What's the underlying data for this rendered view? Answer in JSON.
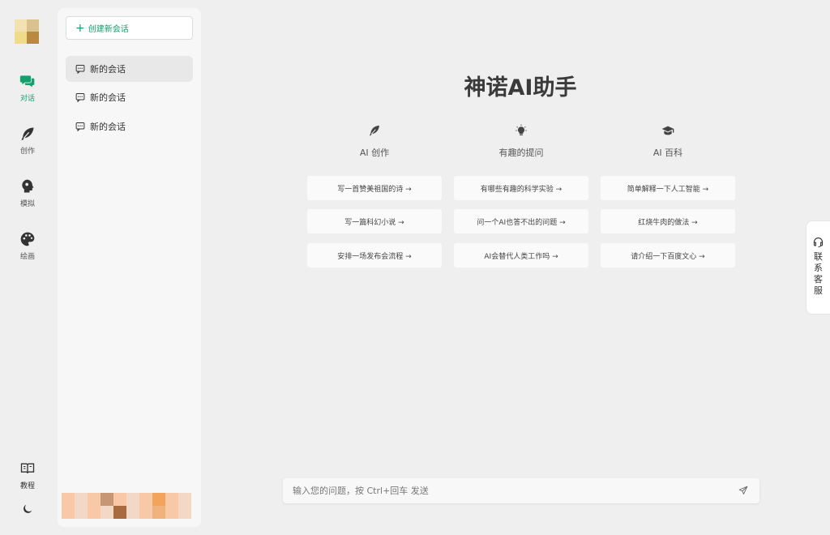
{
  "rail": {
    "items": [
      {
        "label": "对话",
        "icon": "chat-bubbles-icon"
      },
      {
        "label": "创作",
        "icon": "feather-icon"
      },
      {
        "label": "模拟",
        "icon": "head-profile-icon"
      },
      {
        "label": "绘画",
        "icon": "palette-icon"
      }
    ],
    "tutorial_label": "教程",
    "accent": "#12a06c"
  },
  "sessions": {
    "new_label": "创建新会话",
    "items": [
      "新的会话",
      "新的会话",
      "新的会话"
    ]
  },
  "main": {
    "title": "神诺AI助手",
    "columns": [
      {
        "heading": "AI 创作",
        "icon": "feather-icon",
        "prompts": [
          "写一首赞美祖国的诗 →",
          "写一篇科幻小说 →",
          "安排一场发布会流程 →"
        ]
      },
      {
        "heading": "有趣的提问",
        "icon": "lightbulb-icon",
        "prompts": [
          "有哪些有趣的科学实验 →",
          "问一个AI也答不出的问题 →",
          "AI会替代人类工作吗 →"
        ]
      },
      {
        "heading": "AI 百科",
        "icon": "graduation-cap-icon",
        "prompts": [
          "简单解释一下人工智能 →",
          "红烧牛肉的做法 →",
          "请介绍一下百度文心 →"
        ]
      }
    ]
  },
  "input": {
    "placeholder": "输入您的问题，按 Ctrl+回车 发送",
    "value": ""
  },
  "contact": {
    "label": "联系客服"
  }
}
